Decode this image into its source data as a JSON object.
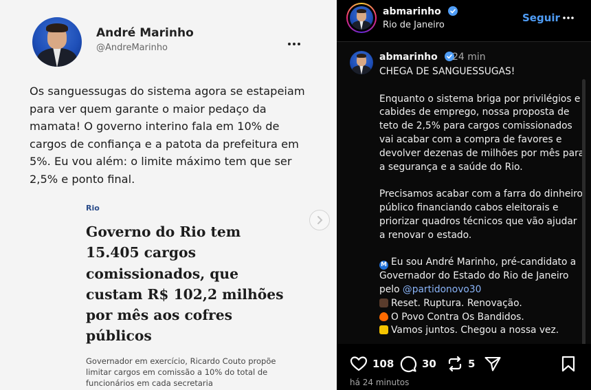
{
  "left_post": {
    "author_name": "André Marinho",
    "author_handle": "@AndreMarinho",
    "more_icon": "…",
    "body": "Os sanguessugas do sistema agora se estapeiam para ver quem garante o maior pedaço da mamata! O governo interino fala em 10% de cargos de confiança e a patota da prefeitura em 5%. Eu vou além: o limite máximo tem que ser 2,5% e ponto final.",
    "article": {
      "section": "Rio",
      "title": "Governo do Rio tem 15.405 cargos comissionados, que custam R$ 102,2 milhões por mês aos cofres públicos",
      "caption": "Governador em exercício, Ricardo Couto propõe limitar cargos em comissão a 10% do total de funcionários em cada secretaria"
    }
  },
  "right_post": {
    "header": {
      "username": "abmarinho",
      "location": "Rio de Janeiro",
      "follow_label": "Seguir",
      "more_icon": "•••"
    },
    "post": {
      "username": "abmarinho",
      "time_ago": "24 min",
      "paragraph1": "CHEGA DE SANGUESSUGAS!",
      "paragraph2": "Enquanto o sistema briga por privilégios e cabides de emprego, nossa proposta de teto de 2,5% para cargos comissionados vai acabar com a compra de favores e devolver dezenas de milhões por mês para a segurança e a saúde do Rio.",
      "paragraph3": "Precisamos acabar com a farra do dinheiro público financiando cabos eleitorais e priorizar quadros técnicos que vão ajudar a renovar o estado.",
      "line_m_pre": "Eu sou André Marinho, pré-candidato a Governador do Estado do Rio de Janeiro pelo ",
      "mention": "@partidonovo30",
      "line_reset": "Reset. Ruptura. Renovação.",
      "line_povo": "O Povo Contra Os Bandidos.",
      "line_vamos": "Vamos juntos. Chegou a nossa vez."
    },
    "actions": {
      "likes": "108",
      "comments": "30",
      "reposts": "5"
    },
    "timestamp": "há 24 minutos",
    "colors": {
      "accent_blue": "#4f9df6",
      "mention": "#8ab4f8"
    }
  }
}
